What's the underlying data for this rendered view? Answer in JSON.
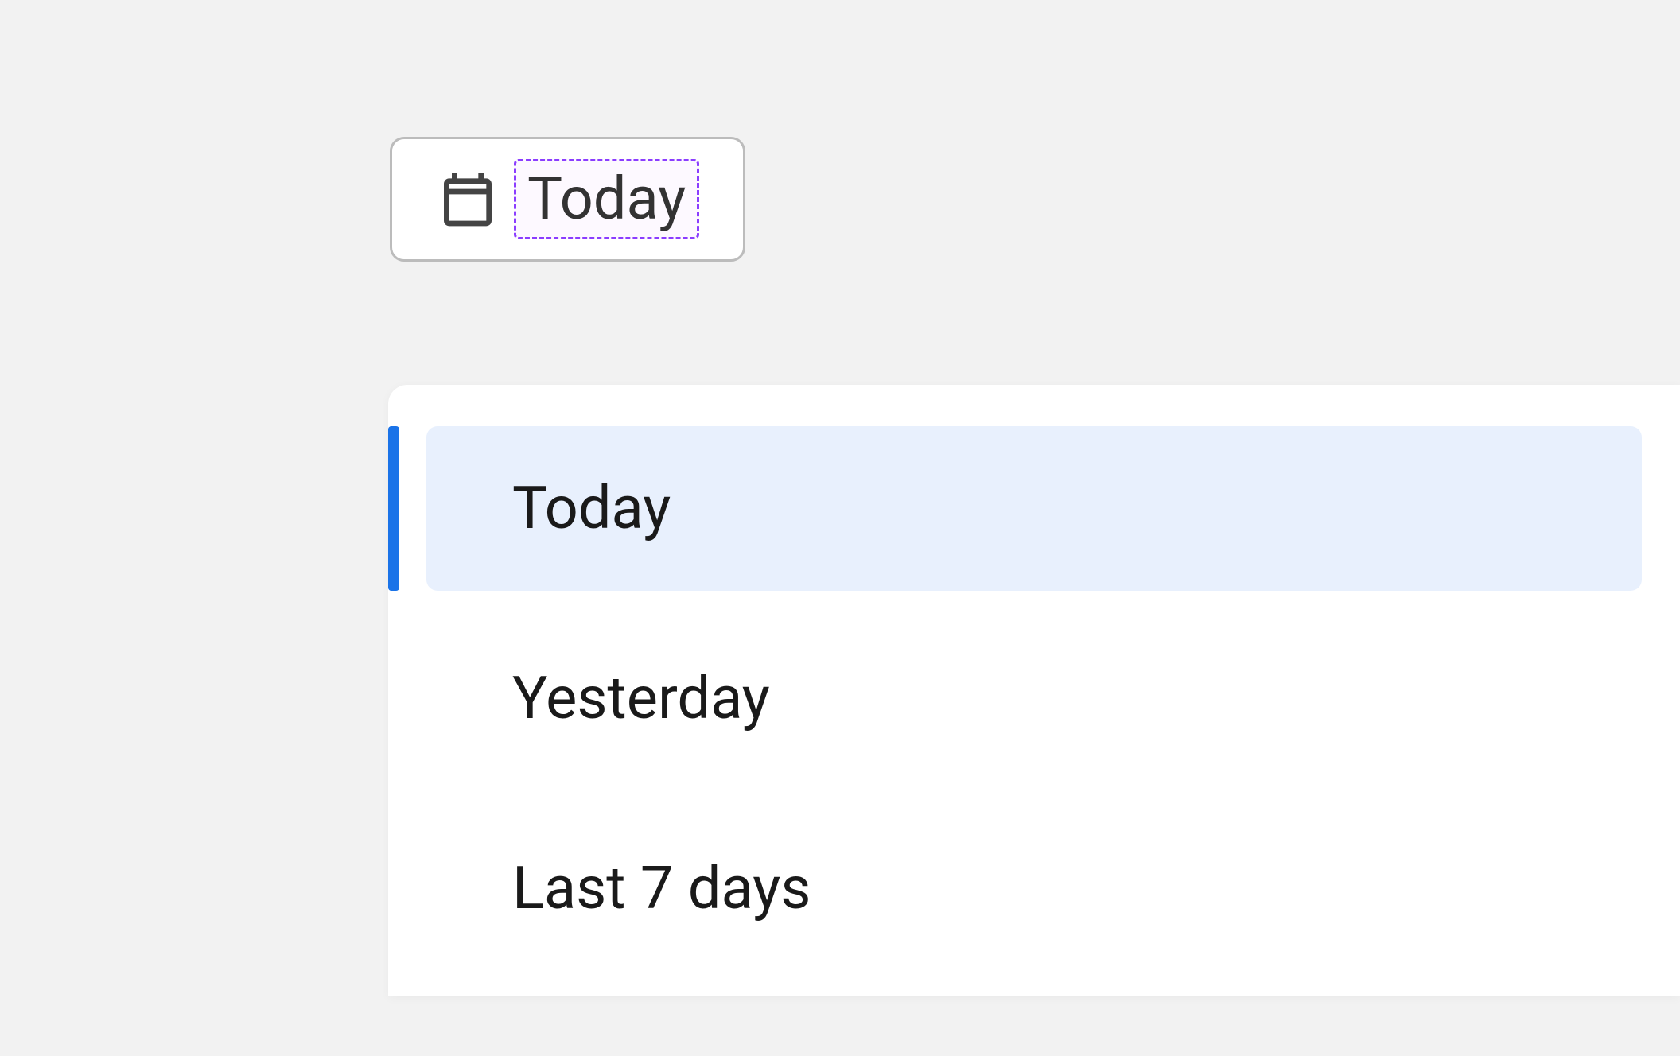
{
  "datePicker": {
    "selectedLabel": "Today",
    "options": [
      {
        "label": "Today",
        "selected": true
      },
      {
        "label": "Yesterday",
        "selected": false
      },
      {
        "label": "Last 7 days",
        "selected": false
      }
    ]
  }
}
